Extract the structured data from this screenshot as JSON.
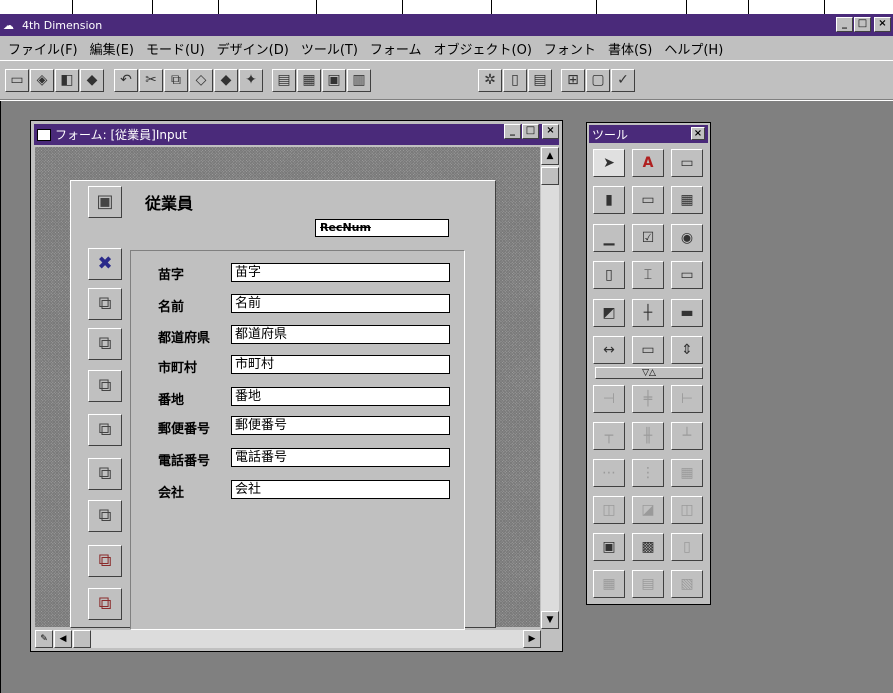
{
  "app": {
    "title": "4th Dimension"
  },
  "window_buttons": {
    "minimize": "_",
    "maximize": "□",
    "close": "×"
  },
  "menu": [
    "ファイル(F)",
    "編集(E)",
    "モード(U)",
    "デザイン(D)",
    "ツール(T)",
    "フォーム",
    "オブジェクト(O)",
    "フォント",
    "書体(S)",
    "ヘルプ(H)"
  ],
  "toolbar_icons": [
    "open-icon",
    "save-icon",
    "preview-icon",
    "print-icon",
    "undo-icon",
    "cut-icon",
    "copy-icon",
    "paste-icon",
    "clear-icon",
    "wand-icon",
    "form-icon-1",
    "form-icon-2",
    "form-icon-3",
    "form-icon-4",
    "gear-icon",
    "list-icon",
    "page-icon",
    "structure-icon",
    "lock-icon",
    "check-icon"
  ],
  "form_window": {
    "title": "フォーム: [従業員]Input",
    "form_title": "従業員",
    "recnum": "RecNum",
    "fields": [
      {
        "label": "苗字",
        "value": "苗字"
      },
      {
        "label": "名前",
        "value": "名前"
      },
      {
        "label": "都道府県",
        "value": "都道府県"
      },
      {
        "label": "市町村",
        "value": "市町村"
      },
      {
        "label": "番地",
        "value": "番地"
      },
      {
        "label": "郵便番号",
        "value": "郵便番号"
      },
      {
        "label": "電話番号",
        "value": "電話番号"
      },
      {
        "label": "会社",
        "value": "会社"
      }
    ]
  },
  "tools_palette": {
    "title": "ツール",
    "close": "×",
    "text_tool": "A"
  }
}
